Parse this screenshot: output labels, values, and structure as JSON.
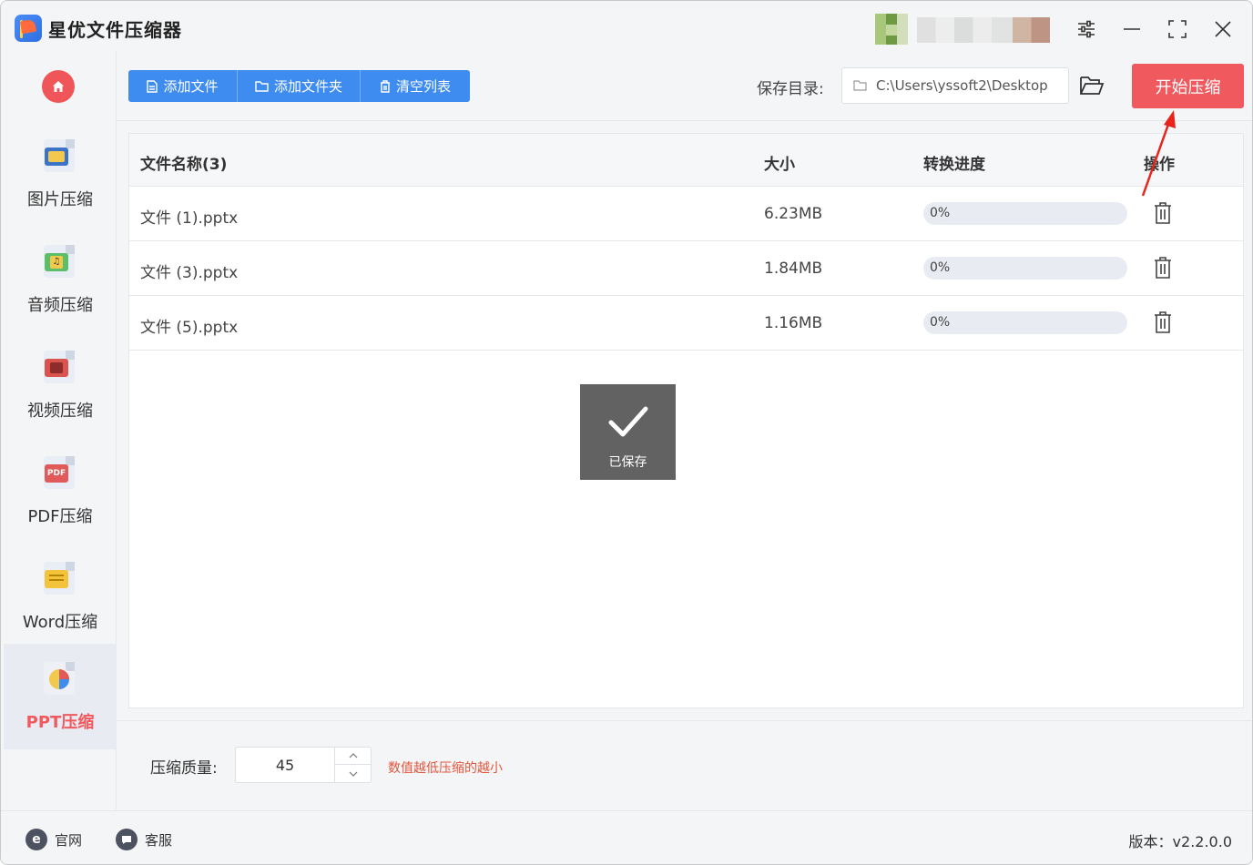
{
  "app": {
    "title": "星优文件压缩器"
  },
  "window_controls": {
    "settings_icon": "sliders-icon",
    "minimize_icon": "minimize-icon",
    "maximize_icon": "fullscreen-icon",
    "close_icon": "close-icon"
  },
  "sidebar": {
    "home_icon": "home-icon",
    "items": [
      {
        "label": "图片压缩",
        "icon": "image-file-icon",
        "active": false
      },
      {
        "label": "音频压缩",
        "icon": "audio-file-icon",
        "active": false
      },
      {
        "label": "视频压缩",
        "icon": "video-file-icon",
        "active": false
      },
      {
        "label": "PDF压缩",
        "icon": "pdf-file-icon",
        "active": false
      },
      {
        "label": "Word压缩",
        "icon": "word-file-icon",
        "active": false
      },
      {
        "label": "PPT压缩",
        "icon": "ppt-file-icon",
        "active": true
      }
    ]
  },
  "toolbar": {
    "add_file": "添加文件",
    "add_folder": "添加文件夹",
    "clear_list": "清空列表",
    "save_dir_label": "保存目录:",
    "save_dir_value": "C:\\Users\\yssoft2\\Desktop",
    "start": "开始压缩"
  },
  "table": {
    "headers": {
      "name": "文件名称(3)",
      "size": "大小",
      "progress": "转换进度",
      "action": "操作"
    },
    "rows": [
      {
        "name": "文件 (1).pptx",
        "size": "6.23MB",
        "progress_text": "0%",
        "progress": 0
      },
      {
        "name": "文件 (3).pptx",
        "size": "1.84MB",
        "progress_text": "0%",
        "progress": 0
      },
      {
        "name": "文件 (5).pptx",
        "size": "1.16MB",
        "progress_text": "0%",
        "progress": 0
      }
    ]
  },
  "toast": {
    "text": "已保存",
    "icon": "checkmark-icon"
  },
  "settings": {
    "quality_label": "压缩质量:",
    "quality_value": "45",
    "hint": "数值越低压缩的越小"
  },
  "footer": {
    "website": "官网",
    "support": "客服",
    "version": "版本：v2.2.0.0"
  },
  "colors": {
    "accent_blue": "#3f8cf1",
    "accent_red": "#f05a5f",
    "hint_orange": "#e4553a"
  }
}
